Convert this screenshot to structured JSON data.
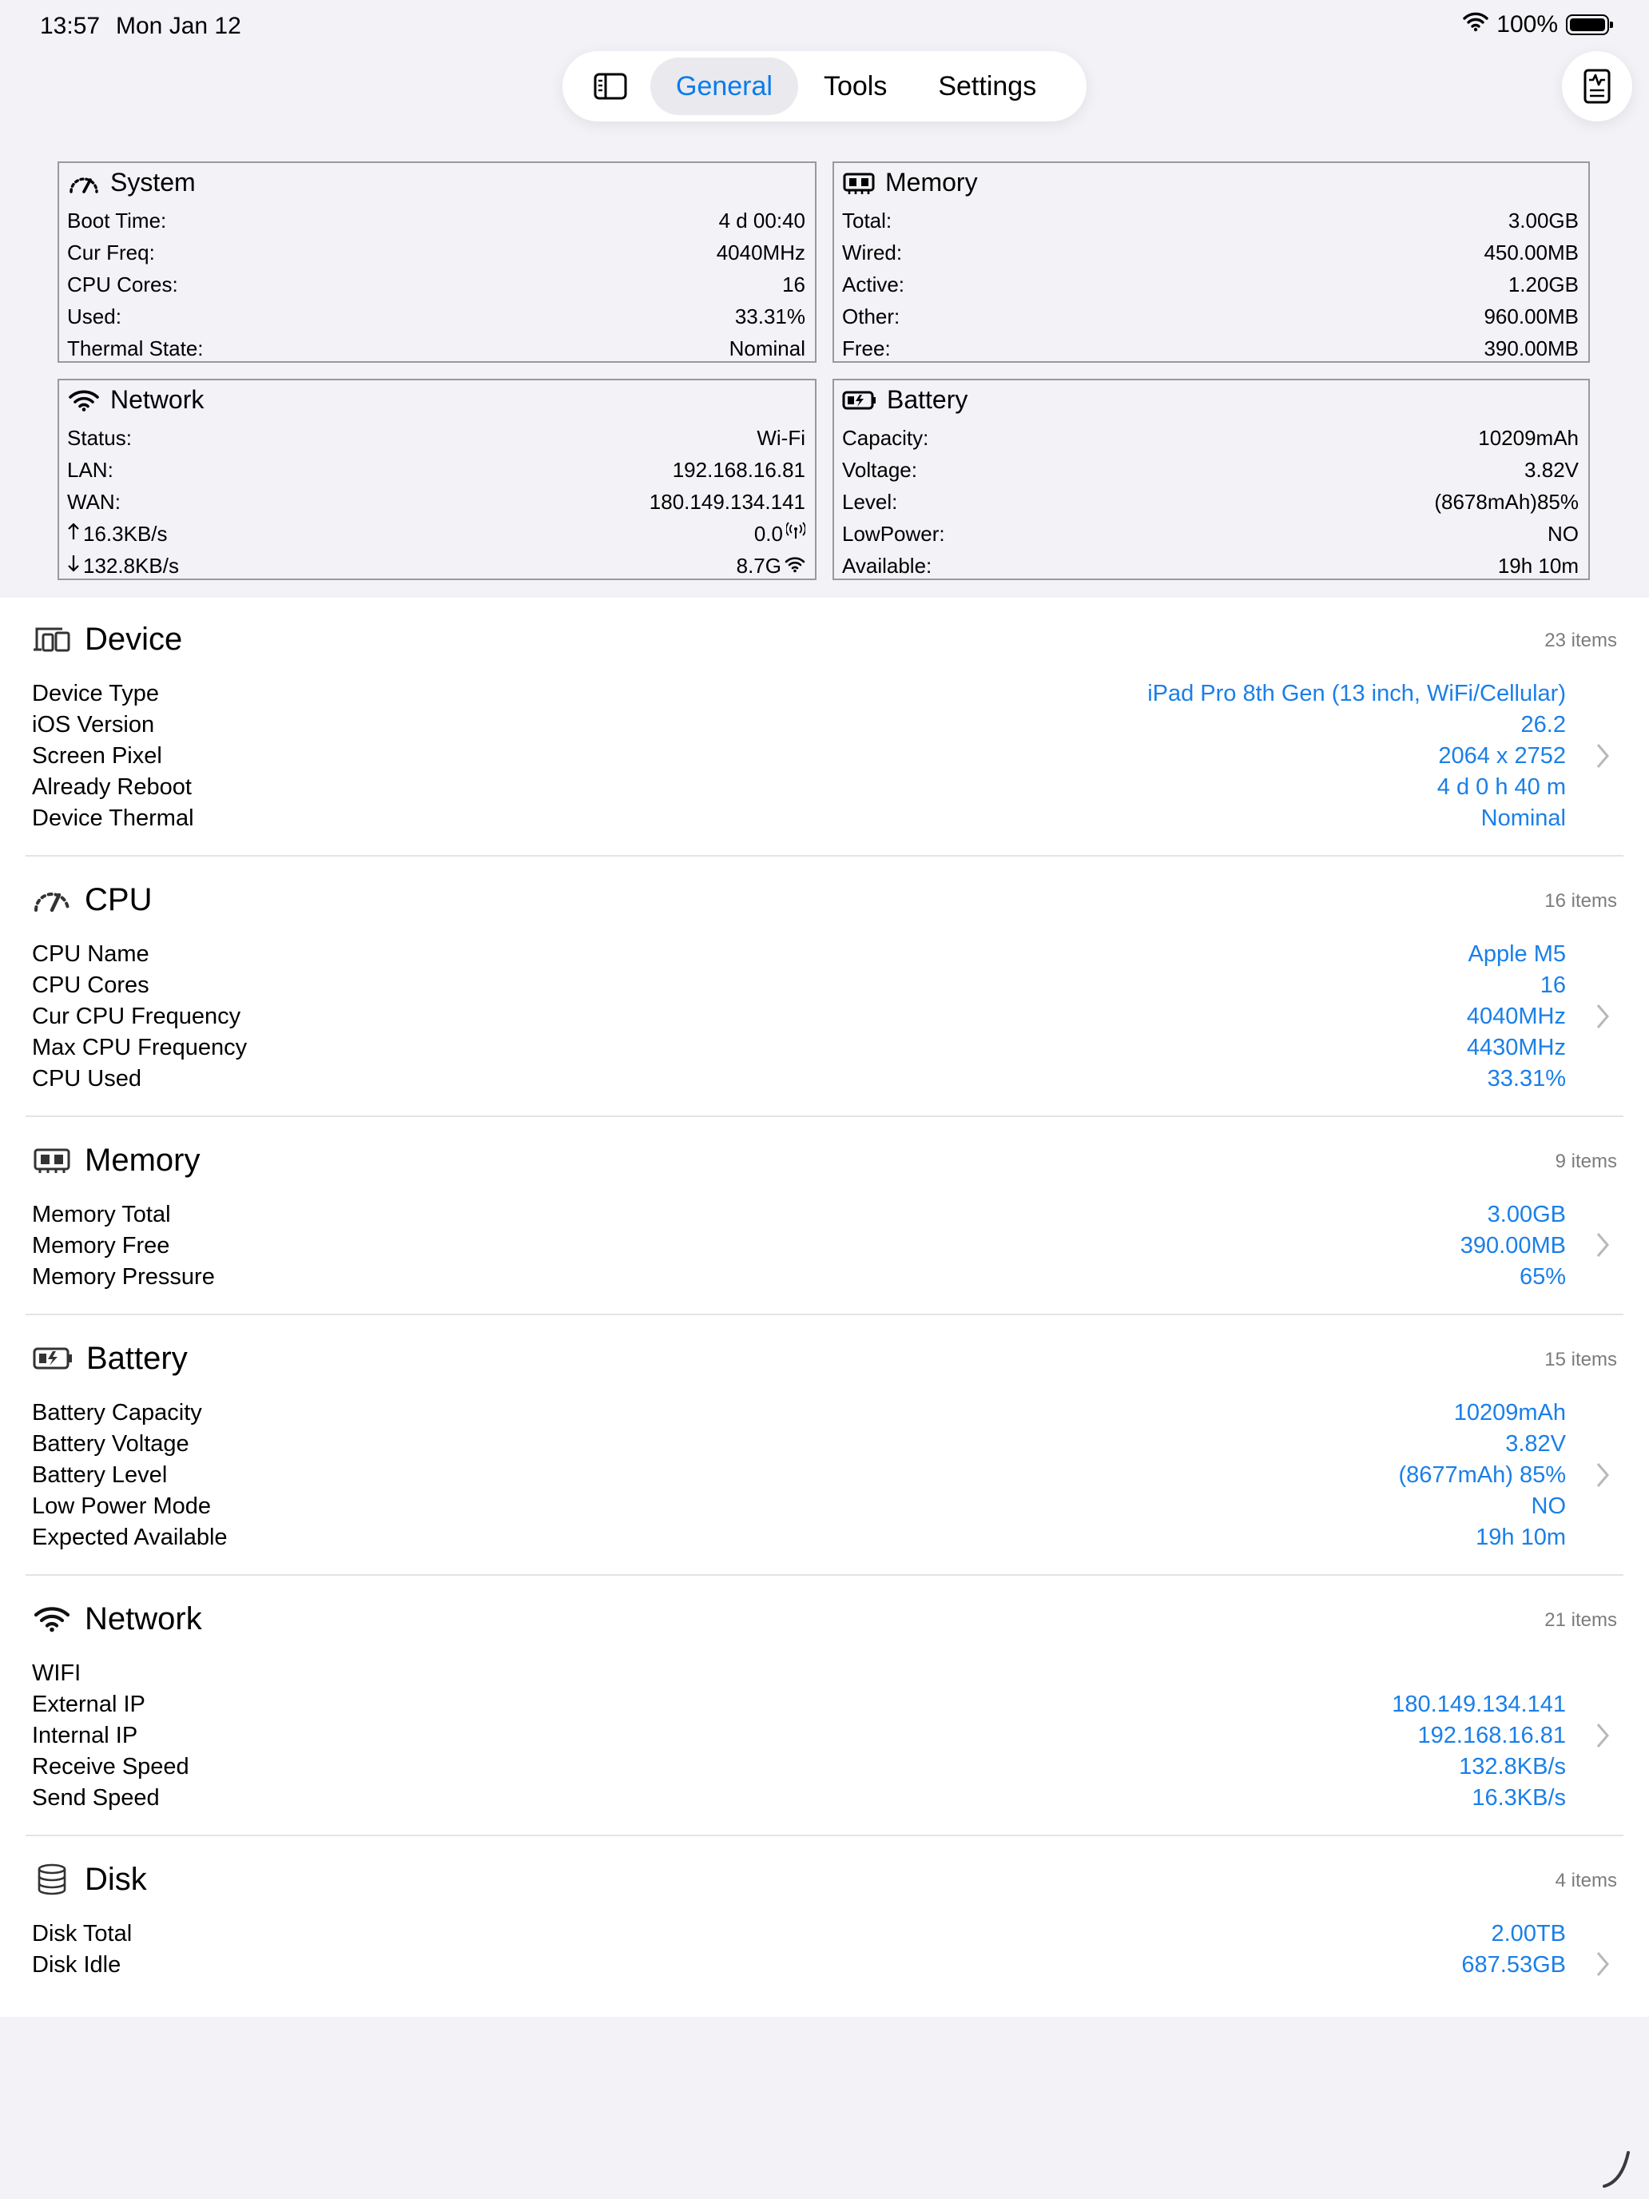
{
  "status_bar": {
    "time": "13:57",
    "date": "Mon Jan 12",
    "battery_percent": "100%",
    "battery_level": 1.0
  },
  "toolbar": {
    "tabs": [
      {
        "label": "General",
        "selected": true
      },
      {
        "label": "Tools",
        "selected": false
      },
      {
        "label": "Settings",
        "selected": false
      }
    ],
    "accent_color": "#0a7bea"
  },
  "summary": {
    "system": {
      "title": "System",
      "rows": [
        {
          "label": "Boot Time:",
          "value": "4 d 00:40"
        },
        {
          "label": "Cur Freq:",
          "value": "4040MHz"
        },
        {
          "label": "CPU Cores:",
          "value": "16"
        },
        {
          "label": "Used:",
          "value": "33.31%"
        },
        {
          "label": "Thermal State:",
          "value": "Nominal"
        }
      ]
    },
    "memory": {
      "title": "Memory",
      "rows": [
        {
          "label": "Total:",
          "value": "3.00GB"
        },
        {
          "label": "Wired:",
          "value": "450.00MB"
        },
        {
          "label": "Active:",
          "value": "1.20GB"
        },
        {
          "label": "Other:",
          "value": "960.00MB"
        },
        {
          "label": "Free:",
          "value": "390.00MB"
        }
      ]
    },
    "network": {
      "title": "Network",
      "rows": [
        {
          "label": "Status:",
          "value": "Wi-Fi"
        },
        {
          "label": "LAN:",
          "value": "192.168.16.81"
        },
        {
          "label": "WAN:",
          "value": "180.149.134.141"
        },
        {
          "label": "16.3KB/s",
          "value": "0.0"
        },
        {
          "label": "132.8KB/s",
          "value": "8.7G"
        }
      ]
    },
    "battery": {
      "title": "Battery",
      "rows": [
        {
          "label": "Capacity:",
          "value": "10209mAh"
        },
        {
          "label": "Voltage:",
          "value": "3.82V"
        },
        {
          "label": "Level:",
          "value": "(8678mAh)85%"
        },
        {
          "label": "LowPower:",
          "value": "NO"
        },
        {
          "label": "Available:",
          "value": "19h 10m"
        }
      ]
    }
  },
  "sections": [
    {
      "title": "Device",
      "count": "23 items",
      "icon": "devices-icon",
      "rows": [
        {
          "label": "Device Type",
          "value": "iPad Pro 8th Gen (13 inch, WiFi/Cellular)"
        },
        {
          "label": "iOS Version",
          "value": "26.2"
        },
        {
          "label": "Screen Pixel",
          "value": "2064 x 2752"
        },
        {
          "label": "Already Reboot",
          "value": "4 d 0 h 40 m"
        },
        {
          "label": "Device Thermal",
          "value": "Nominal"
        }
      ]
    },
    {
      "title": "CPU",
      "count": "16 items",
      "icon": "gauge-icon",
      "rows": [
        {
          "label": "CPU Name",
          "value": "Apple M5"
        },
        {
          "label": "CPU Cores",
          "value": "16"
        },
        {
          "label": "Cur CPU Frequency",
          "value": "4040MHz"
        },
        {
          "label": "Max CPU Frequency",
          "value": "4430MHz"
        },
        {
          "label": "CPU Used",
          "value": "33.31%"
        }
      ]
    },
    {
      "title": "Memory",
      "count": "9 items",
      "icon": "memory-chip-icon",
      "rows": [
        {
          "label": "Memory Total",
          "value": "3.00GB"
        },
        {
          "label": "Memory Free",
          "value": "390.00MB"
        },
        {
          "label": "Memory Pressure",
          "value": "65%"
        }
      ]
    },
    {
      "title": "Battery",
      "count": "15 items",
      "icon": "battery-charging-icon",
      "rows": [
        {
          "label": "Battery Capacity",
          "value": "10209mAh"
        },
        {
          "label": "Battery Voltage",
          "value": "3.82V"
        },
        {
          "label": "Battery Level",
          "value": "(8677mAh) 85%"
        },
        {
          "label": "Low Power Mode",
          "value": "NO"
        },
        {
          "label": "Expected Available",
          "value": "19h 10m"
        }
      ]
    },
    {
      "title": "Network",
      "count": "21 items",
      "icon": "wifi-icon",
      "rows": [
        {
          "label": "WIFI",
          "value": ""
        },
        {
          "label": "External IP",
          "value": "180.149.134.141"
        },
        {
          "label": "Internal IP",
          "value": "192.168.16.81"
        },
        {
          "label": "Receive Speed",
          "value": "132.8KB/s"
        },
        {
          "label": "Send Speed",
          "value": "16.3KB/s"
        }
      ]
    },
    {
      "title": "Disk",
      "count": "4 items",
      "icon": "disk-stack-icon",
      "rows": [
        {
          "label": "Disk Total",
          "value": "2.00TB"
        },
        {
          "label": "Disk Idle",
          "value": "687.53GB"
        }
      ]
    }
  ]
}
